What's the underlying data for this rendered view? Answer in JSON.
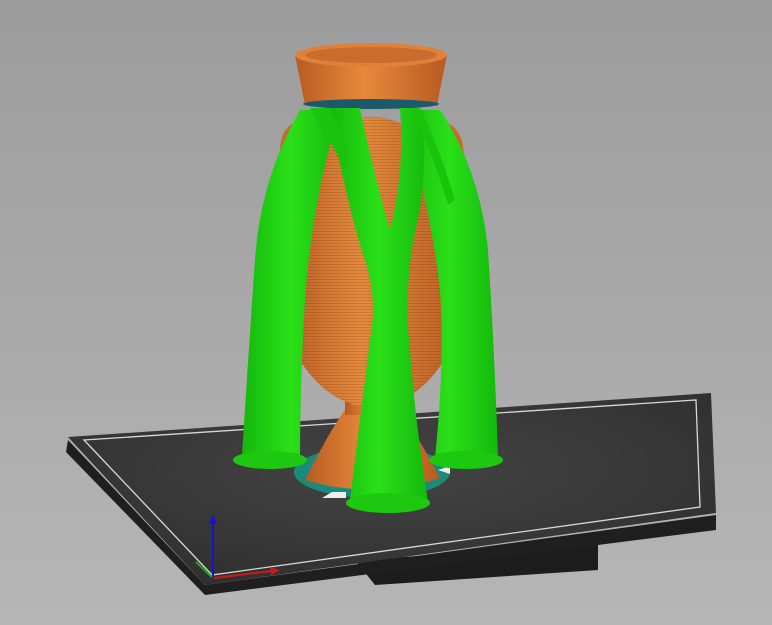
{
  "viewport": {
    "mode": "3d-preview",
    "colors": {
      "background_top": "#9e9e9e",
      "background_bottom": "#b4b4b4",
      "bed": "#363636",
      "bed_side": "#1f1f1f",
      "bed_border": "#d8d8d8",
      "model": "#d9782f",
      "model_dark": "#a85220",
      "support": "#1fd60f",
      "support_dark": "#10a008",
      "brim": "#1a8a7a",
      "axis_x": "#d01818",
      "axis_y": "#1aa81a",
      "axis_z": "#1414c8"
    }
  }
}
